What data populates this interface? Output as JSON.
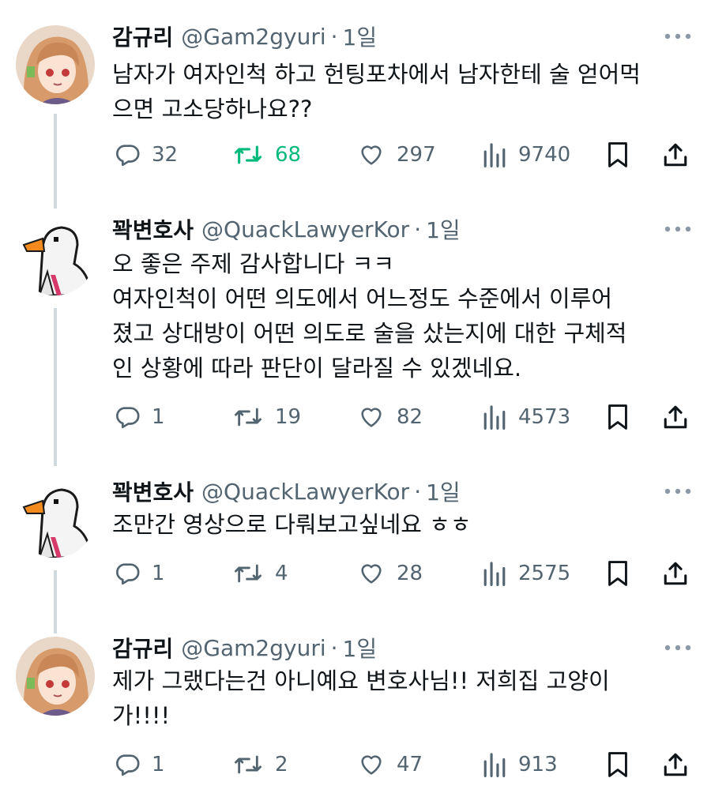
{
  "colors": {
    "text": "#0f1419",
    "secondary": "#536471",
    "retweet_active": "#00ba7c",
    "thread_line": "#cfd9de"
  },
  "icons": {
    "more": "more-dots-icon",
    "reply": "reply-icon",
    "retweet": "retweet-icon",
    "like": "like-heart-icon",
    "views": "views-bars-icon",
    "bookmark": "bookmark-icon",
    "share": "share-icon"
  },
  "tweets": [
    {
      "name": "감규리",
      "handle": "@Gam2gyuri",
      "separator": "·",
      "time": "1일",
      "lines": [
        "남자가 여자인척 하고 헌팅포차에서 남자한테 술 얻어먹",
        "으면 고소당하나요??"
      ],
      "replies": "32",
      "retweets": "68",
      "retweeted": true,
      "likes": "297",
      "views": "9740"
    },
    {
      "name": "꽉변호사",
      "handle": "@QuackLawyerKor",
      "separator": "·",
      "time": "1일",
      "lines": [
        "오 좋은 주제 감사합니다 ㅋㅋ",
        "여자인척이 어떤 의도에서 어느정도 수준에서 이루어",
        "졌고 상대방이 어떤 의도로 술을 샀는지에 대한 구체적",
        "인 상황에 따라 판단이 달라질 수 있겠네요."
      ],
      "replies": "1",
      "retweets": "19",
      "retweeted": false,
      "likes": "82",
      "views": "4573"
    },
    {
      "name": "꽉변호사",
      "handle": "@QuackLawyerKor",
      "separator": "·",
      "time": "1일",
      "lines": [
        "조만간 영상으로 다뤄보고싶네요 ㅎㅎ"
      ],
      "replies": "1",
      "retweets": "4",
      "retweeted": false,
      "likes": "28",
      "views": "2575"
    },
    {
      "name": "감규리",
      "handle": "@Gam2gyuri",
      "separator": "·",
      "time": "1일",
      "lines": [
        "제가 그랬다는건 아니예요 변호사님!! 저희집 고양이",
        "가!!!!"
      ],
      "replies": "1",
      "retweets": "2",
      "retweeted": false,
      "likes": "47",
      "views": "913"
    }
  ]
}
